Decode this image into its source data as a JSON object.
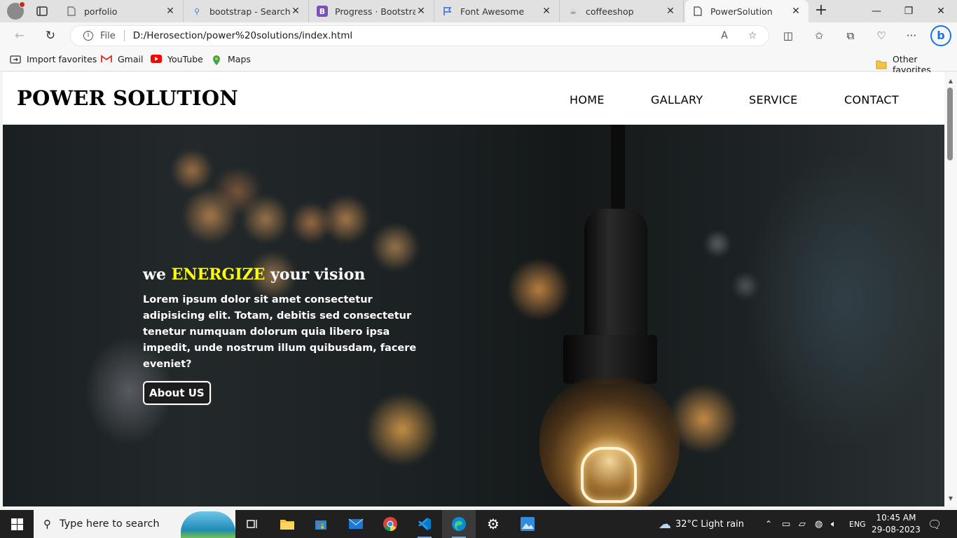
{
  "browser": {
    "tabs": [
      {
        "title": "porfolio",
        "icon": "page-icon"
      },
      {
        "title": "bootstrap - Search",
        "icon": "search-icon"
      },
      {
        "title": "Progress · Bootstrap v",
        "icon": "bootstrap-icon"
      },
      {
        "title": "Font Awesome",
        "icon": "flag-icon"
      },
      {
        "title": "coffeeshop",
        "icon": "coffee-icon"
      },
      {
        "title": "PowerSolution",
        "icon": "page-icon"
      }
    ],
    "active_tab": 5,
    "address": {
      "scheme_label": "File",
      "url": "D:/Herosection/power%20solutions/index.html"
    },
    "favorites": [
      {
        "label": "Import favorites"
      },
      {
        "label": "Gmail"
      },
      {
        "label": "YouTube"
      },
      {
        "label": "Maps"
      }
    ],
    "other_favorites": "Other favorites"
  },
  "site": {
    "brand": "POWER SOLUTION",
    "menu": [
      "HOME",
      "GALLARY",
      "SERVICE",
      "CONTACT"
    ],
    "hero": {
      "title_prefix": "we ",
      "title_highlight": "ENERGIZE",
      "title_suffix": " your vision",
      "paragraph": "Lorem ipsum dolor sit amet consectetur adipisicing elit. Totam, debitis sed consectetur tenetur numquam dolorum quia libero ipsa impedit, unde nostrum illum quibusdam, facere eveniet?",
      "button": "About US"
    },
    "colors": {
      "highlight": "#ffff00"
    }
  },
  "taskbar": {
    "search_placeholder": "Type here to search",
    "weather": "32°C  Light rain",
    "language": "ENG",
    "time": "10:45 AM",
    "date": "29-08-2023"
  }
}
